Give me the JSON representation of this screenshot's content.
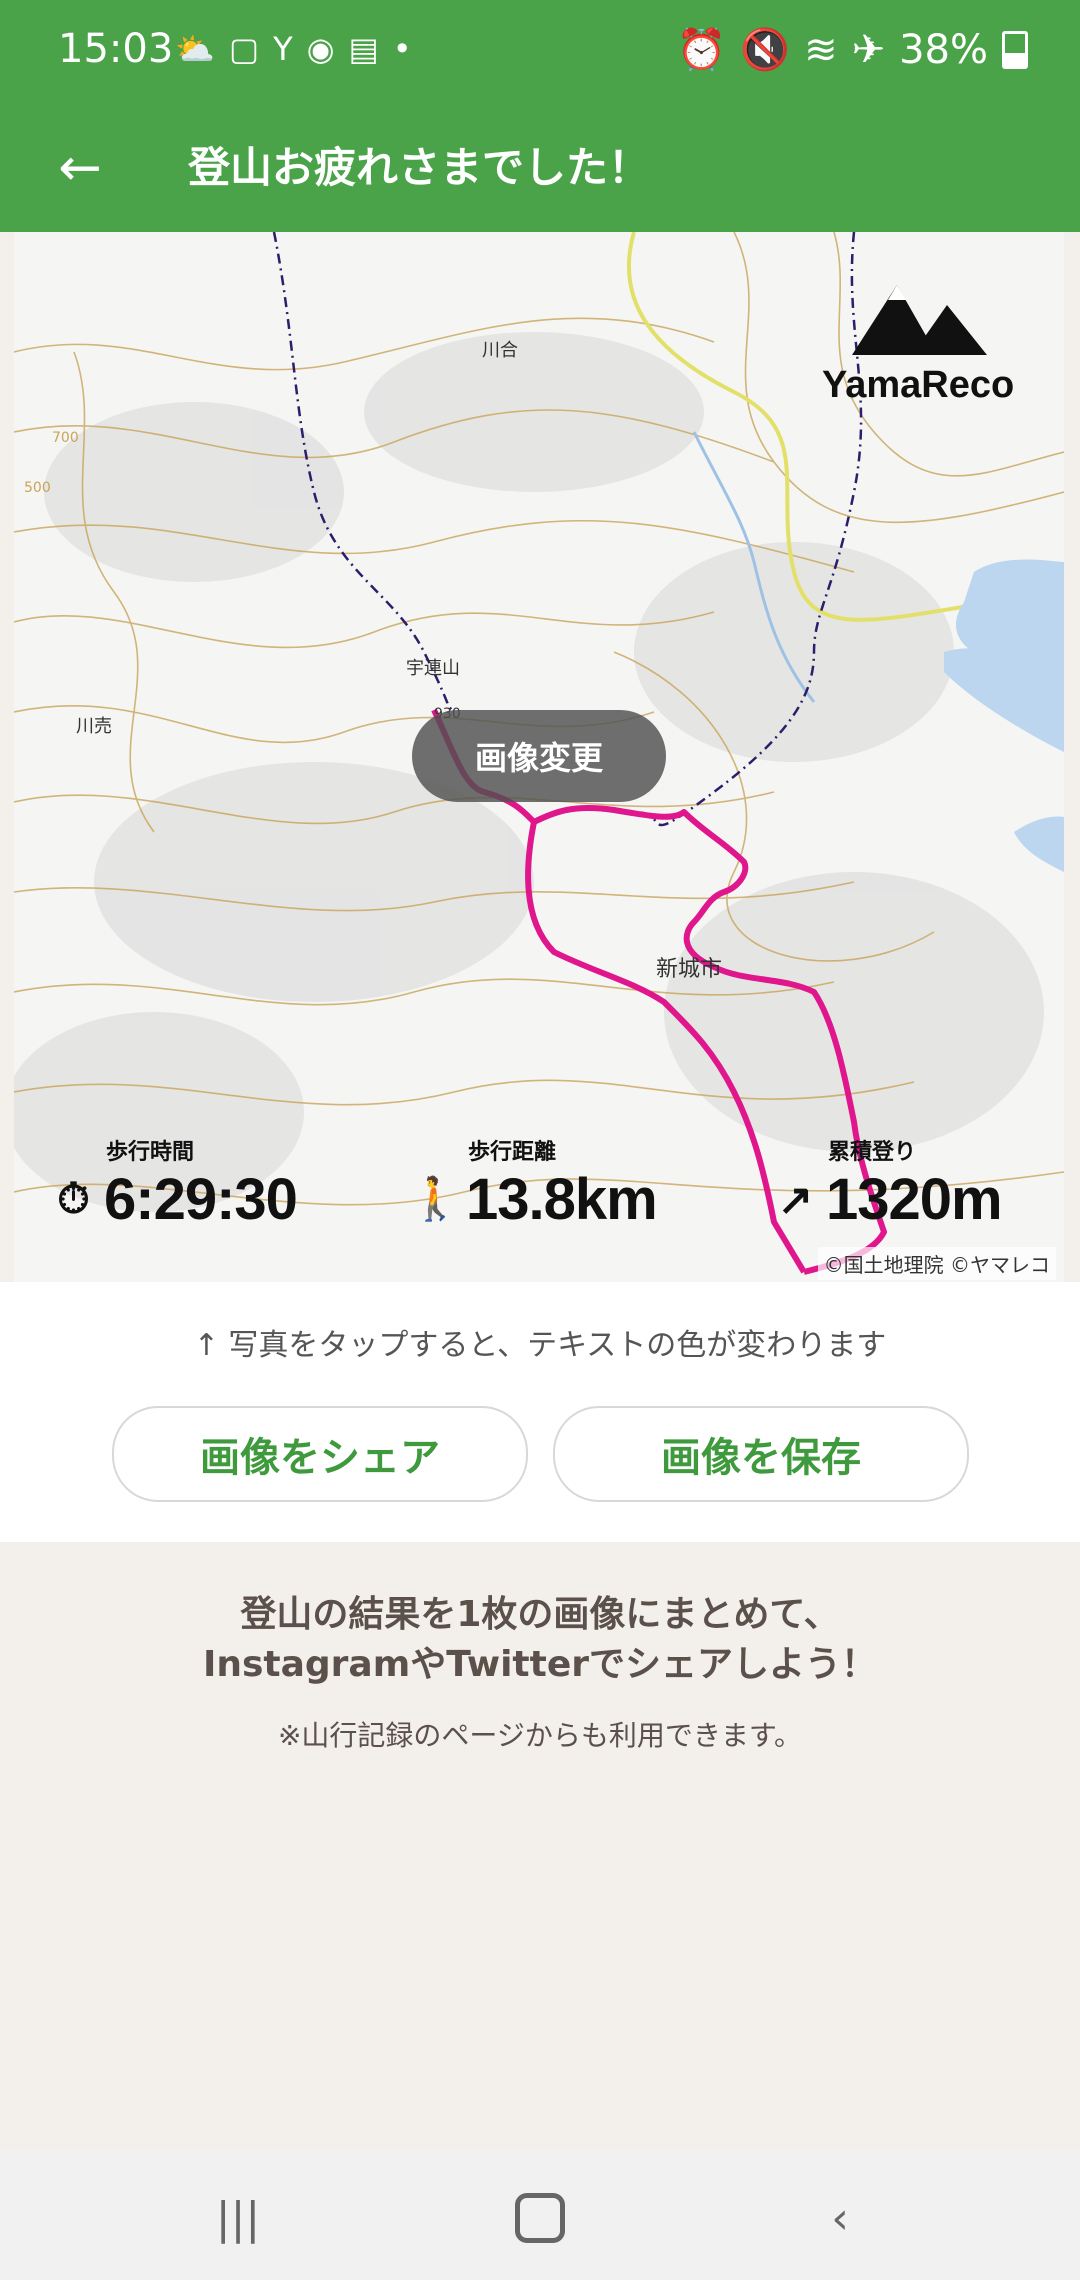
{
  "status": {
    "time": "15:03",
    "battery": "38%",
    "left_icons": [
      "weather-icon",
      "box-icon",
      "yahoo-icon",
      "chrome-icon",
      "news-icon",
      "dot-icon"
    ],
    "right_icons": [
      "alarm-icon",
      "mute-icon",
      "wifi-icon",
      "airplane-icon"
    ]
  },
  "appbar": {
    "title": "登山お疲れさまでした！"
  },
  "map": {
    "logo": "YamaReco",
    "change_button": "画像変更",
    "labels": {
      "place1": "川合",
      "place2": "宇連山",
      "place3": "川売",
      "place4": "新城市",
      "elev": "930",
      "c700": "700",
      "c500": "500"
    },
    "stats": [
      {
        "label": "歩行時間",
        "value": "6:29:30",
        "icon": "stopwatch-icon"
      },
      {
        "label": "歩行距離",
        "value": "13.8km",
        "icon": "walker-icon"
      },
      {
        "label": "累積登り",
        "value": "1320m",
        "icon": "up-arrow-icon"
      }
    ],
    "credit": "©国土地理院 ©ヤマレコ",
    "accent_color": "#e0168c"
  },
  "panel": {
    "hint": "↑ 写真をタップすると、テキストの色が変わります",
    "share_button": "画像をシェア",
    "save_button": "画像を保存"
  },
  "promo": {
    "line1": "登山の結果を1枚の画像にまとめて、",
    "line2": "InstagramやTwitterでシェアしよう！",
    "note": "※山行記録のページからも利用できます。"
  },
  "colors": {
    "brand_green": "#4aa348",
    "button_text": "#3f9a3d",
    "background": "#f3f0eb"
  }
}
